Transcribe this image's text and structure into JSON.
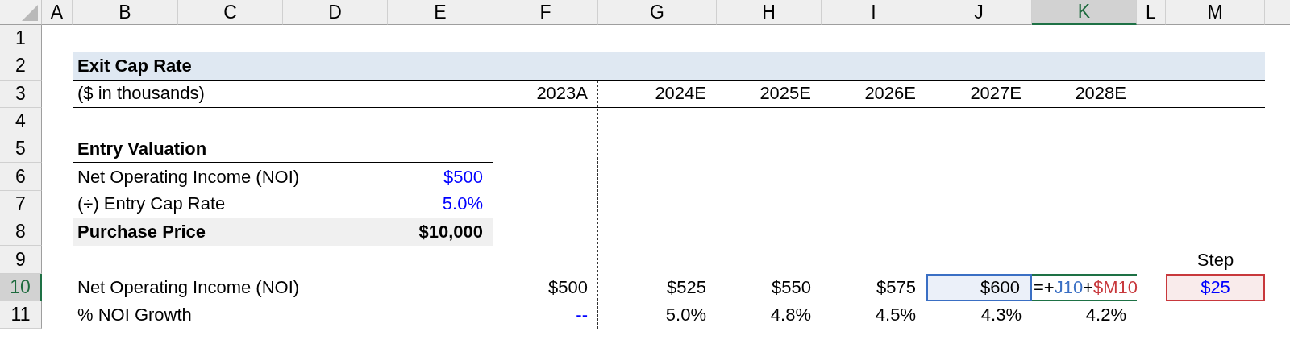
{
  "columns": [
    {
      "label": "A",
      "selected": false
    },
    {
      "label": "B",
      "selected": false
    },
    {
      "label": "C",
      "selected": false
    },
    {
      "label": "D",
      "selected": false
    },
    {
      "label": "E",
      "selected": false
    },
    {
      "label": "F",
      "selected": false
    },
    {
      "label": "G",
      "selected": false
    },
    {
      "label": "H",
      "selected": false
    },
    {
      "label": "I",
      "selected": false
    },
    {
      "label": "J",
      "selected": false
    },
    {
      "label": "K",
      "selected": true
    },
    {
      "label": "L",
      "selected": false
    },
    {
      "label": "M",
      "selected": false
    }
  ],
  "row_headers": [
    {
      "number": "1",
      "selected": false
    },
    {
      "number": "2",
      "selected": false
    },
    {
      "number": "3",
      "selected": false
    },
    {
      "number": "4",
      "selected": false
    },
    {
      "number": "5",
      "selected": false
    },
    {
      "number": "6",
      "selected": false
    },
    {
      "number": "7",
      "selected": false
    },
    {
      "number": "8",
      "selected": false
    },
    {
      "number": "9",
      "selected": false
    },
    {
      "number": "10",
      "selected": true
    },
    {
      "number": "11",
      "selected": false
    }
  ],
  "title": "Exit Cap Rate",
  "period_row": {
    "label": "($ in thousands)",
    "periods": [
      "2023A",
      "2024E",
      "2025E",
      "2026E",
      "2027E",
      "2028E"
    ]
  },
  "entry_valuation": {
    "heading": "Entry Valuation",
    "lines": [
      {
        "label": "Net Operating Income (NOI)",
        "value": "$500",
        "kind": "input"
      },
      {
        "label": "(÷) Entry Cap Rate",
        "value": "5.0%",
        "kind": "input"
      }
    ],
    "total": {
      "label": "Purchase Price",
      "value": "$10,000"
    }
  },
  "step": {
    "label": "Step",
    "value": "$25",
    "kind": "input",
    "color": "#c8383c"
  },
  "noi_row": {
    "label": "Net Operating Income (NOI)",
    "values": [
      {
        "kind": "calc",
        "text": "$500"
      },
      {
        "kind": "calc",
        "text": "$525"
      },
      {
        "kind": "calc",
        "text": "$550"
      },
      {
        "kind": "calc",
        "text": "$575"
      },
      {
        "kind": "calc",
        "text": "$600",
        "color": "#3a6fc4"
      },
      {
        "kind": "formula",
        "parts": [
          {
            "text": "=+",
            "color": "#000000"
          },
          {
            "text": "J10",
            "color": "#3a6fc4"
          },
          {
            "text": "+",
            "color": "#000000"
          },
          {
            "text": "$M10",
            "color": "#c8383c"
          }
        ]
      }
    ]
  },
  "growth_row": {
    "label": "% NOI Growth",
    "values": [
      {
        "kind": "input",
        "text": "--"
      },
      {
        "kind": "calc",
        "text": "5.0%"
      },
      {
        "kind": "calc",
        "text": "4.8%"
      },
      {
        "kind": "calc",
        "text": "4.5%"
      },
      {
        "kind": "calc",
        "text": "4.3%"
      },
      {
        "kind": "calc",
        "text": "4.2%"
      }
    ]
  }
}
